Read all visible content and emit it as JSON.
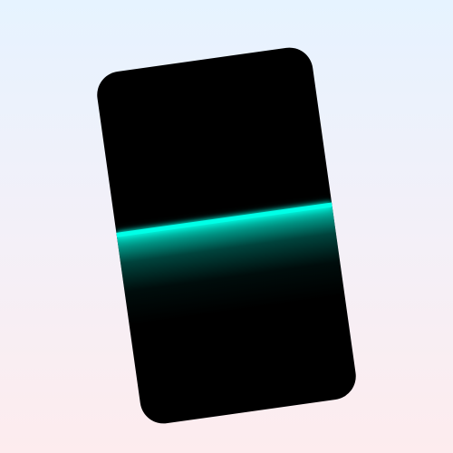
{
  "scene": {
    "background_top": "#e6f3ff",
    "background_bottom": "#fdecee"
  },
  "device": {
    "body_color": "#000000",
    "scan_line_color": "#00ffe7",
    "scan_progress": 0.45
  }
}
